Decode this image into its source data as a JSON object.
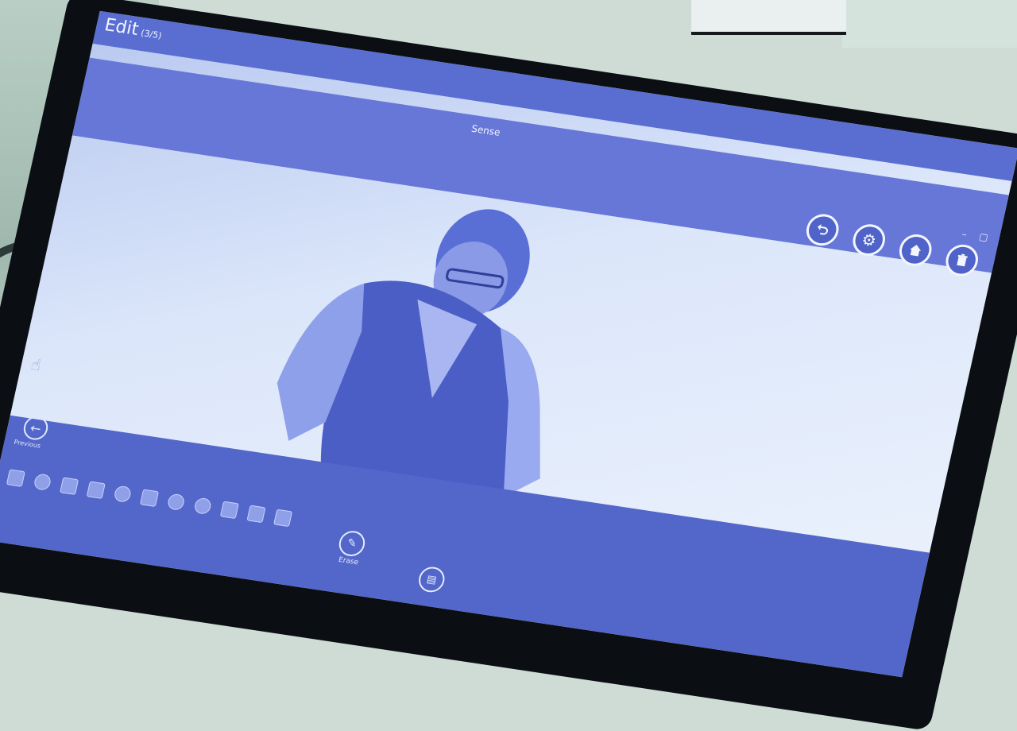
{
  "header": {
    "title": "Edit",
    "counter": "(3/5)"
  },
  "window": {
    "title": "Sense",
    "controls": "– ▢"
  },
  "toolbar": {
    "undo_icon": "undo-icon",
    "settings_icon": "gear-icon",
    "home_icon": "home-icon",
    "delete_icon": "trash-icon"
  },
  "bottom": {
    "back_label": "Previous",
    "erase_label": "Erase"
  },
  "colors": {
    "accent": "#5a6ed2",
    "toolbar": "#6677d8",
    "bottom_bar": "#5366c9"
  }
}
